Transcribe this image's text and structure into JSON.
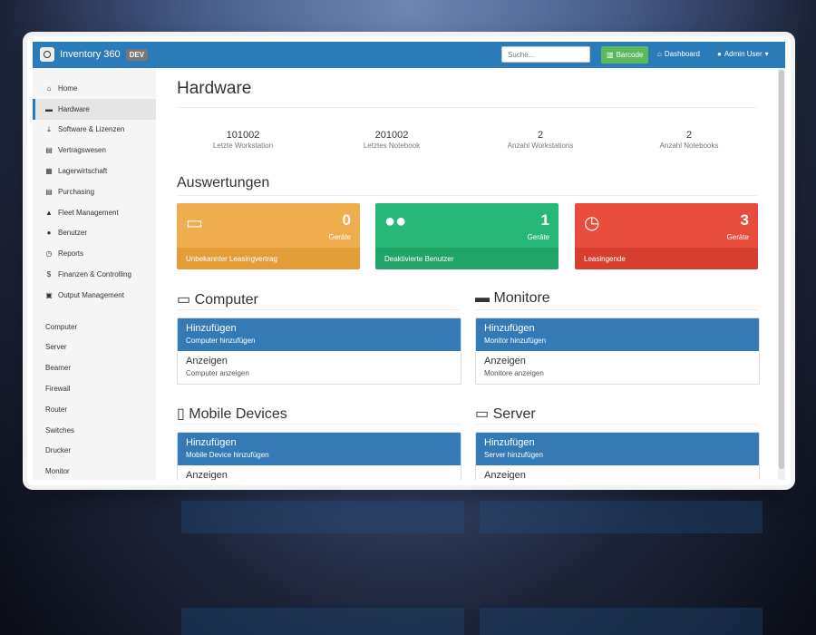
{
  "navbar": {
    "brand": "Inventory 360",
    "badge": "DEV",
    "search_placeholder": "Suche...",
    "barcode": "Barcode",
    "dashboard": "Dashboard",
    "user": "Admin User"
  },
  "sidebar": {
    "primary": [
      {
        "label": "Home",
        "icon": "home-icon",
        "glyph": "⌂"
      },
      {
        "label": "Hardware",
        "icon": "hdd-icon",
        "glyph": "▬",
        "active": true
      },
      {
        "label": "Software & Lizenzen",
        "icon": "download-icon",
        "glyph": "⤓"
      },
      {
        "label": "Vertragswesen",
        "icon": "file-icon",
        "glyph": "▤"
      },
      {
        "label": "Lagerwirtschaft",
        "icon": "grid-icon",
        "glyph": "▦"
      },
      {
        "label": "Purchasing",
        "icon": "list-icon",
        "glyph": "▤"
      },
      {
        "label": "Fleet Management",
        "icon": "road-icon",
        "glyph": "▲"
      },
      {
        "label": "Benutzer",
        "icon": "user-icon",
        "glyph": "●"
      },
      {
        "label": "Reports",
        "icon": "clock-icon",
        "glyph": "◷"
      },
      {
        "label": "Finanzen & Controlling",
        "icon": "dollar-icon",
        "glyph": "$"
      },
      {
        "label": "Output Management",
        "icon": "print-icon",
        "glyph": "▣"
      }
    ],
    "secondary": [
      "Computer",
      "Server",
      "Beamer",
      "Firewall",
      "Router",
      "Switches",
      "Drucker",
      "Monitor"
    ]
  },
  "main": {
    "title": "Hardware",
    "stats": [
      {
        "value": "101002",
        "label": "Letzte Workstation"
      },
      {
        "value": "201002",
        "label": "Letztes Notebook"
      },
      {
        "value": "2",
        "label": "Anzahl Workstations"
      },
      {
        "value": "2",
        "label": "Anzahl Notebooks"
      }
    ],
    "auswertungen_title": "Auswertungen",
    "panels": [
      {
        "count": "0",
        "unit": "Geräte",
        "footer": "Unbekannter Leasingvertrag",
        "icon": "laptop-icon",
        "color": "#f0ad4e",
        "footer_color": "#e49e39"
      },
      {
        "count": "1",
        "unit": "Geräte",
        "footer": "Deaktivierte Benutzer",
        "icon": "users-icon",
        "color": "#26b877",
        "footer_color": "#20a468"
      },
      {
        "count": "3",
        "unit": "Geräte",
        "footer": "Leasingende",
        "icon": "clock-icon",
        "color": "#e74c3c",
        "footer_color": "#d63f30"
      }
    ],
    "sections": [
      {
        "title": "Computer",
        "icon": "laptop-icon",
        "add": "Hinzufügen",
        "add_sub": "Computer hinzufügen",
        "show": "Anzeigen",
        "show_sub": "Computer anzeigen"
      },
      {
        "title": "Monitore",
        "icon": "monitor-icon",
        "add": "Hinzufügen",
        "add_sub": "Monitor hinzufügen",
        "show": "Anzeigen",
        "show_sub": "Monitore anzeigen"
      },
      {
        "title": "Mobile Devices",
        "icon": "mobile-icon",
        "add": "Hinzufügen",
        "add_sub": "Mobile Device hinzufügen",
        "show": "Anzeigen",
        "show_sub": ""
      },
      {
        "title": "Server",
        "icon": "hdd-icon",
        "add": "Hinzufügen",
        "add_sub": "Server hinzufügen",
        "show": "Anzeigen",
        "show_sub": ""
      }
    ]
  }
}
